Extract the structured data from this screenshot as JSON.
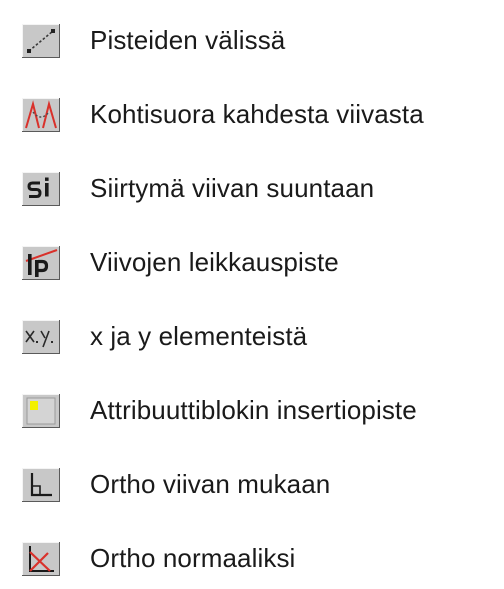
{
  "menu": {
    "items": [
      {
        "label": "Pisteiden välissä",
        "icon": "line-between-points-icon"
      },
      {
        "label": "Kohtisuora kahdesta viivasta",
        "icon": "perpendicular-two-lines-icon"
      },
      {
        "label": "Siirtymä viivan suuntaan",
        "icon": "si-offset-icon"
      },
      {
        "label": "Viivojen leikkauspiste",
        "icon": "lp-intersection-icon"
      },
      {
        "label": "x ja y elementeistä",
        "icon": "xy-elements-icon"
      },
      {
        "label": "Attribuuttiblokin insertiopiste",
        "icon": "attribute-block-insertion-icon"
      },
      {
        "label": "Ortho viivan mukaan",
        "icon": "ortho-line-icon"
      },
      {
        "label": "Ortho normaaliksi",
        "icon": "ortho-normal-icon"
      }
    ]
  },
  "colors": {
    "icon_face": "#c8c8c8",
    "icon_border_dark": "#5a5a5a",
    "icon_border_light": "#f4f4f4",
    "accent_red": "#d9312b",
    "accent_yellow": "#f3f000"
  }
}
